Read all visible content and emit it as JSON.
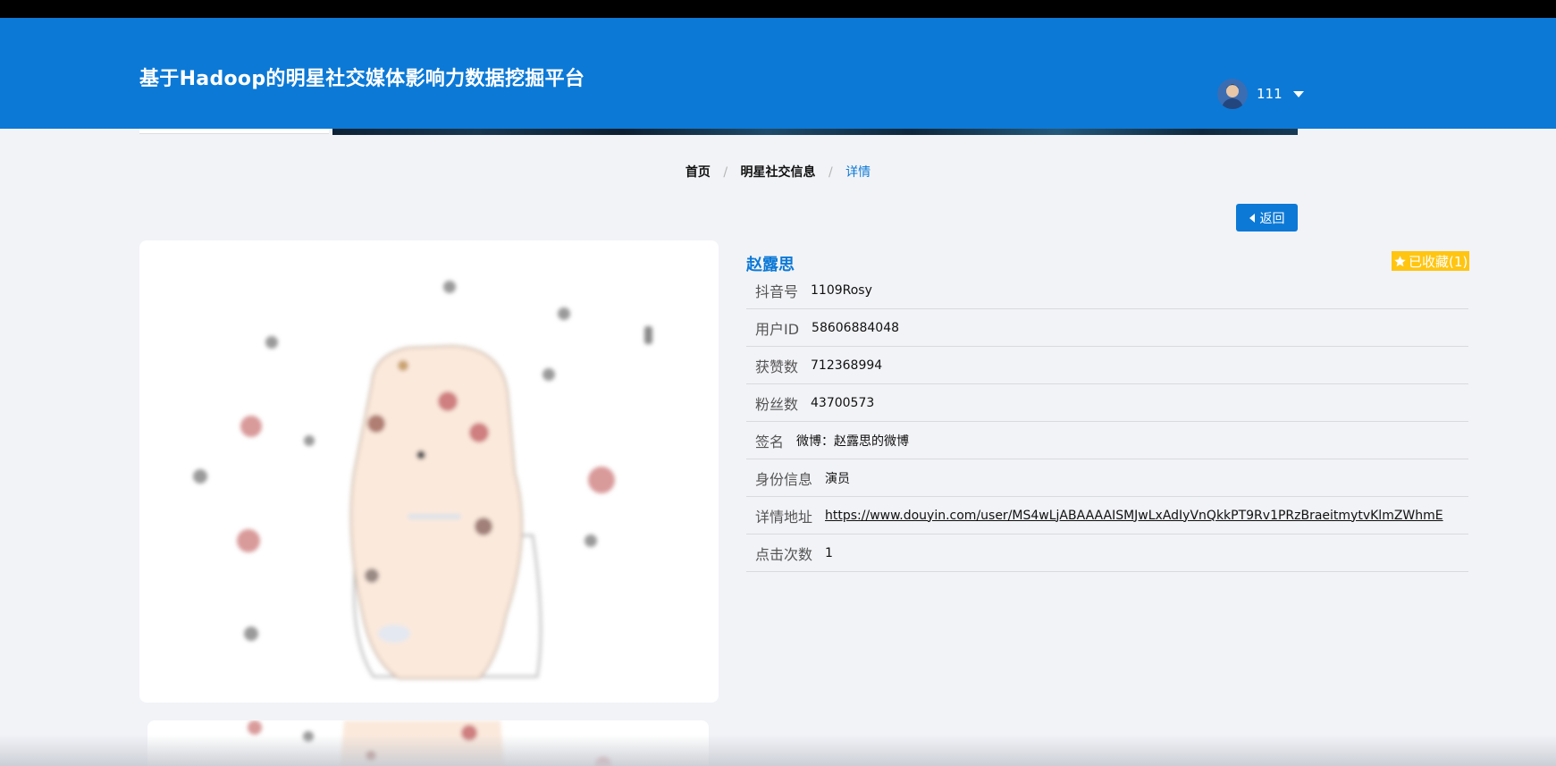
{
  "header": {
    "title": "基于Hadoop的明星社交媒体影响力数据挖掘平台",
    "username": "111"
  },
  "breadcrumb": {
    "home": "首页",
    "section": "明星社交信息",
    "current": "详情",
    "separator": "/"
  },
  "back_button": {
    "label": "返回"
  },
  "detail": {
    "name": "赵露思",
    "favorite_label": "已收藏(1)",
    "fields": [
      {
        "label": "抖音号",
        "value": "1109Rosy"
      },
      {
        "label": "用户ID",
        "value": "58606884048"
      },
      {
        "label": "获赞数",
        "value": "712368994"
      },
      {
        "label": "粉丝数",
        "value": "43700573"
      },
      {
        "label": "签名",
        "value": "微博：赵露思的微博"
      },
      {
        "label": "身份信息",
        "value": "演员"
      },
      {
        "label": "详情地址",
        "value": "https://www.douyin.com/user/MS4wLjABAAAAISMJwLxAdIyVnQkkPT9Rv1PRzBraeitmytvKlmZWhmE"
      },
      {
        "label": "点击次数",
        "value": "1"
      }
    ]
  },
  "colors": {
    "header": "#0c79d6",
    "accent": "#0c79d6",
    "favorite": "#ffc511",
    "background": "#f2f3f7"
  },
  "icons": {
    "user_menu": "caret-down-icon",
    "back": "caret-left-icon",
    "favorite": "star-icon"
  }
}
